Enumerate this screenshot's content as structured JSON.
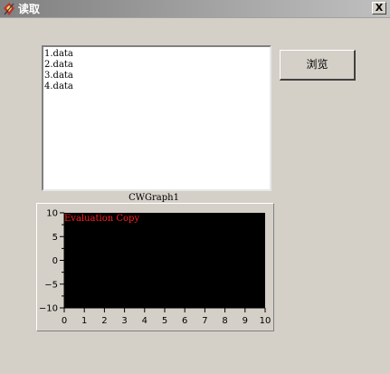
{
  "window": {
    "title": "读取",
    "close_label": "X",
    "icon": "app-icon"
  },
  "file_list": {
    "items": [
      "1.data",
      "2.data",
      "3.data",
      "4.data"
    ]
  },
  "browse_button": {
    "label": "浏览"
  },
  "graph": {
    "caption": "CWGraph1",
    "watermark": "Evaluation Copy",
    "plot_background": "#000000",
    "watermark_color": "#ff2020"
  },
  "chart_data": {
    "type": "line",
    "title": "",
    "xlabel": "",
    "ylabel": "",
    "xlim": [
      0,
      10
    ],
    "ylim": [
      -10,
      10
    ],
    "x_ticks": [
      "0",
      "1",
      "2",
      "3",
      "4",
      "5",
      "6",
      "7",
      "8",
      "9",
      "10"
    ],
    "y_ticks": [
      "10",
      "5",
      "0",
      "-5",
      "-10"
    ],
    "series": [],
    "grid": false
  }
}
